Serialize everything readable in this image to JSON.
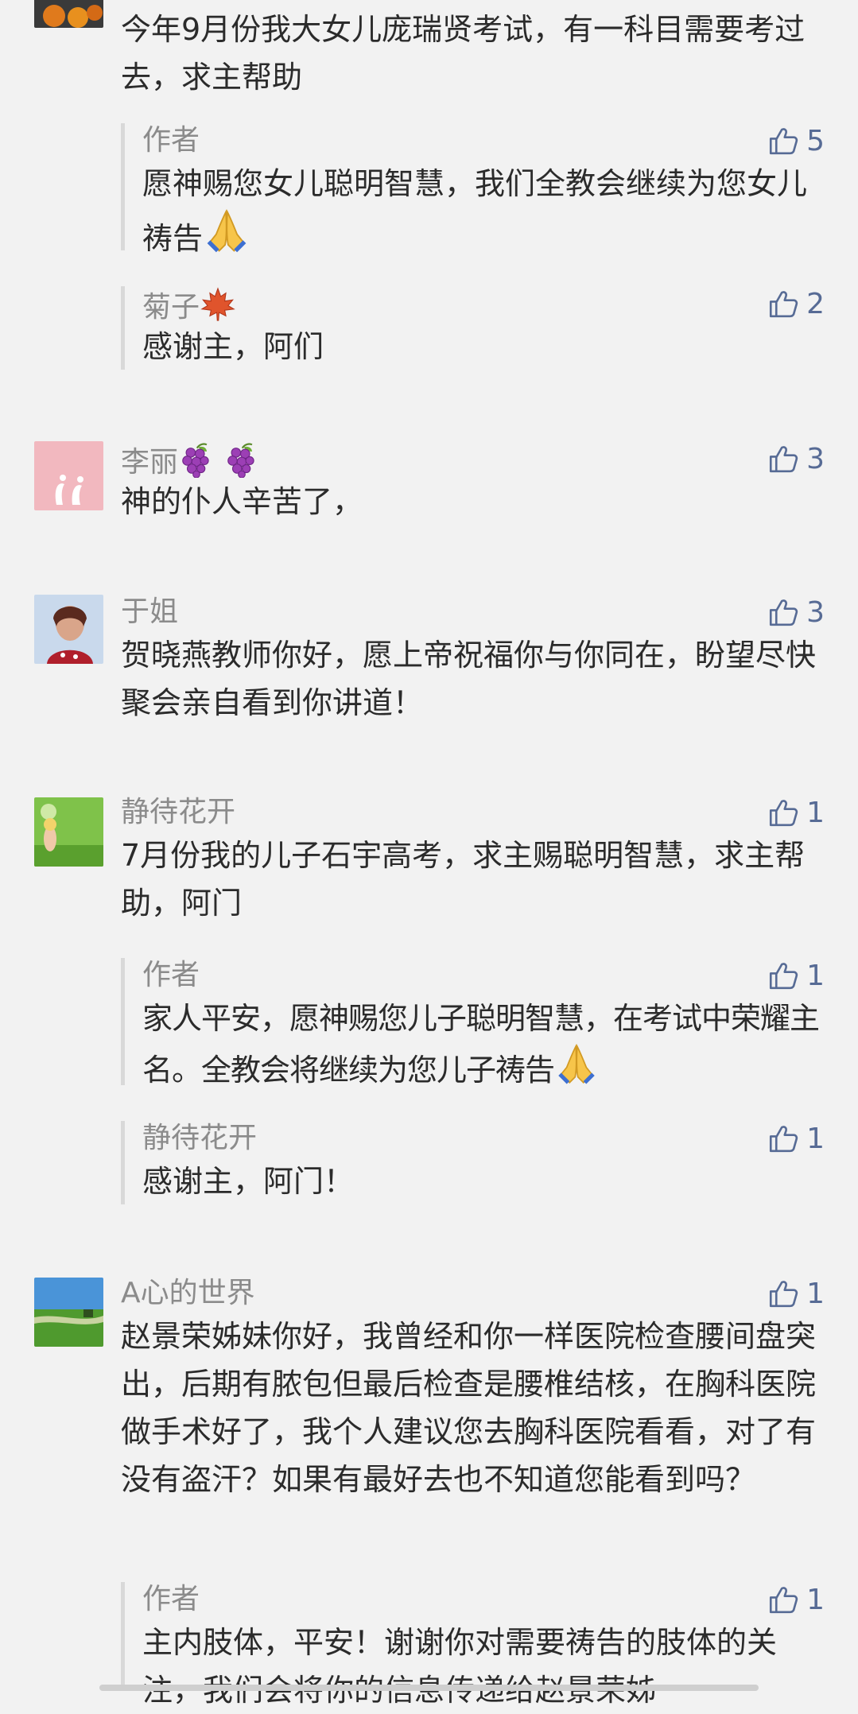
{
  "comments": [
    {
      "text": "今年9月份我大女儿庞瑞贤考试，有一科目需要考过去，求主帮助",
      "replies": [
        {
          "nick": "作者",
          "likes": "5",
          "text": "愿神赐您女儿聪明智慧，我们全教会继续为您女儿祷告"
        },
        {
          "nick": "菊子",
          "likes": "2",
          "text": "感谢主，阿们"
        }
      ]
    },
    {
      "nick": "李丽",
      "likes": "3",
      "text": "神的仆人辛苦了，"
    },
    {
      "nick": "于姐",
      "likes": "3",
      "text": "贺晓燕教师你好，愿上帝祝福你与你同在，盼望尽快聚会亲自看到你讲道！"
    },
    {
      "nick": "静待花开",
      "likes": "1",
      "text": "7月份我的儿子石宇高考，求主赐聪明智慧，求主帮助，阿门",
      "replies": [
        {
          "nick": "作者",
          "likes": "1",
          "text": "家人平安，愿神赐您儿子聪明智慧，在考试中荣耀主名。全教会将继续为您儿子祷告"
        },
        {
          "nick": "静待花开",
          "likes": "1",
          "text": "感谢主，阿门！"
        }
      ]
    },
    {
      "nick": "A心的世界",
      "likes": "1",
      "text": "赵景荣姊妹你好，我曾经和你一样医院检查腰间盘突出，后期有脓包但最后检查是腰椎结核，在胸科医院做手术好了，我个人建议您去胸科医院看看，对了有没有盗汗？如果有最好去也不知道您能看到吗？",
      "replies": [
        {
          "nick": "作者",
          "likes": "1",
          "text": "主内肢体，平安！谢谢你对需要祷告的肢体的关注，我们会将你的信息传递给赵景荣姊"
        }
      ]
    }
  ],
  "icons": {
    "like": "thumbs-up-outline-icon",
    "pray": "folded-hands-emoji",
    "maple": "maple-leaf-emoji",
    "grapes": "grapes-emoji"
  },
  "colors": {
    "background": "#f2f2f2",
    "link": "#576b95",
    "nick": "#8b8b8b",
    "text": "#2b2b2b"
  }
}
